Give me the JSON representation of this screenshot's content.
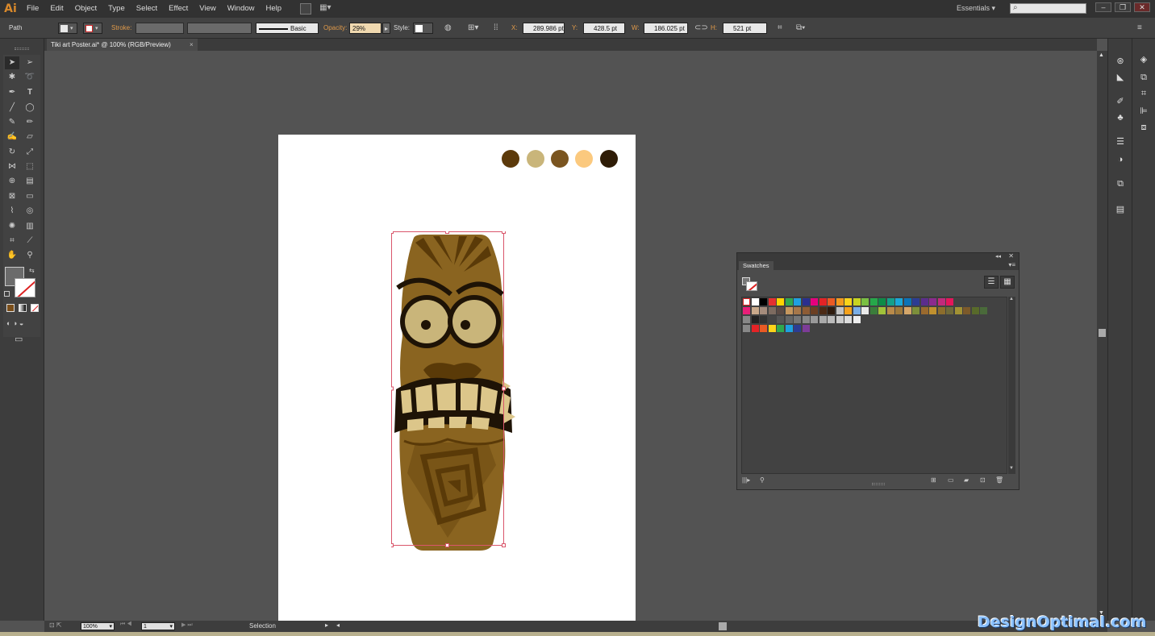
{
  "app": {
    "logo": "Ai"
  },
  "menu": [
    "File",
    "Edit",
    "Object",
    "Type",
    "Select",
    "Effect",
    "View",
    "Window",
    "Help"
  ],
  "workspace": {
    "label": "Essentials",
    "arrow": "▾"
  },
  "search": {
    "icon": "search-icon",
    "glyph": "⌕"
  },
  "window_buttons": [
    "–",
    "❐",
    "✕"
  ],
  "control": {
    "selection_type": "Path",
    "stroke_label": "Stroke:",
    "brush_label": "Basic",
    "opacity_label": "Opacity:",
    "opacity_value": "29%",
    "style_label": "Style:",
    "x_label": "X:",
    "x_value": "289.986 pt",
    "y_label": "Y:",
    "y_value": "428.5 pt",
    "w_label": "W:",
    "w_value": "186.025 pt",
    "h_label": "H:",
    "h_value": "521 pt"
  },
  "document_tab": {
    "title": "Tiki art Poster.ai* @ 100% (RGB/Preview)",
    "close": "×"
  },
  "palette_colors": [
    "#5c3a0b",
    "#c9b57a",
    "#7a5520",
    "#fbc97e",
    "#2e1c06"
  ],
  "tiki_colors": {
    "wood": "#8a6420",
    "dark": "#5a3a08",
    "eye": "#c9b57a",
    "outline": "#1e1306",
    "tooth": "#dcc68a"
  },
  "swatches_panel": {
    "title": "Swatches"
  },
  "status": {
    "zoom": "100%",
    "artboard": "1",
    "mode": "Selection"
  },
  "watermark": "DesignOptimal.com"
}
